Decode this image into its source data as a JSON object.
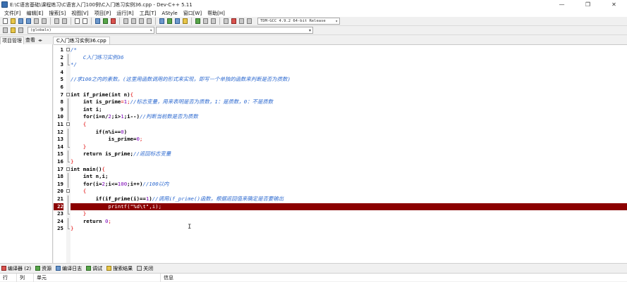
{
  "window": {
    "title": "E:\\C语言基础\\课程练习\\C语言入门100例\\C入门练习实例36.cpp - Dev-C++ 5.11",
    "minimize": "—",
    "maximize": "❐",
    "close": "✕"
  },
  "menu": [
    "文件[F]",
    "编辑[E]",
    "搜索[S]",
    "视图[V]",
    "项目[P]",
    "运行[R]",
    "工具[T]",
    "AStyle",
    "窗口[W]",
    "帮助[H]"
  ],
  "toolbar": {
    "compiler": "TDM-GCC 4.9.2 64-bit Release",
    "scope": "(globals)"
  },
  "left_panel": {
    "tabs": [
      "项目管理",
      "查看"
    ],
    "arrows": "◂▸"
  },
  "editor": {
    "file_tab": "C入门练习实例36.cpp",
    "line_numbers": [
      "1",
      "2",
      "3",
      "4",
      "5",
      "6",
      "7",
      "8",
      "9",
      "10",
      "11",
      "12",
      "13",
      "14",
      "15",
      "16",
      "17",
      "18",
      "19",
      "20",
      "21",
      "22",
      "23",
      "24",
      "25"
    ],
    "code": {
      "l1": "/*",
      "l2": "    C入门练习实例36",
      "l3": "*/",
      "l5": "//求100之内的素数。(这里用函数调用的形式来实现，即写一个单独的函数来判断是否为质数)",
      "l7a": "int",
      "l7b": " if_prime(",
      "l7c": "int",
      "l7d": " n)",
      "l7e": "{",
      "l8a": "    ",
      "l8b": "int",
      "l8c": " is_prime",
      "l8d": "=",
      "l8e": "1",
      "l8f": ";",
      "l8g": "//标志变量，用来表明是否为质数，1：是质数，0：不是质数",
      "l9a": "    ",
      "l9b": "int",
      "l9c": " i;",
      "l10a": "    ",
      "l10b": "for",
      "l10c": "(i=n/",
      "l10d": "2",
      "l10e": ";i>",
      "l10f": "1",
      "l10g": ";i--)",
      "l10h": "//判断当前数是否为质数",
      "l11": "    {",
      "l12a": "        ",
      "l12b": "if",
      "l12c": "(n%i==",
      "l12d": "0",
      "l12e": ")",
      "l13a": "            is_prime=",
      "l13b": "0",
      "l13c": ";",
      "l14": "    }",
      "l15a": "    ",
      "l15b": "return",
      "l15c": " is_prime;",
      "l15d": "//返回标志变量",
      "l16": "}",
      "l17a": "int",
      "l17b": " main()",
      "l17c": "{",
      "l18a": "    ",
      "l18b": "int",
      "l18c": " n,i;",
      "l19a": "    ",
      "l19b": "for",
      "l19c": "(i=",
      "l19d": "2",
      "l19e": ";i<=",
      "l19f": "100",
      "l19g": ";i++)",
      "l19h": "//100以内",
      "l20": "    {",
      "l21a": "        ",
      "l21b": "if",
      "l21c": "(if_prime(i)==",
      "l21d": "1",
      "l21e": ")",
      "l21f": "//调用if_prime()函数，根据返回值来确定是否要输出",
      "l22a": "            printf(",
      "l22b": "\"%d\\t\"",
      "l22c": ",i);",
      "l23": "    }",
      "l24a": "    ",
      "l24b": "return",
      "l24c": " ",
      "l24d": "0",
      "l24e": ";",
      "l25": "}"
    },
    "cursor_glyph": "I"
  },
  "bottom": {
    "tabs": [
      {
        "label": "编译器 (2)",
        "icon": "compiler-icon"
      },
      {
        "label": "资源",
        "icon": "resources-icon"
      },
      {
        "label": "编译日志",
        "icon": "compile-log-icon"
      },
      {
        "label": "调试",
        "icon": "debug-icon"
      },
      {
        "label": "搜索结果",
        "icon": "search-results-icon"
      },
      {
        "label": "关闭",
        "icon": "close-icon"
      }
    ],
    "columns": [
      "行",
      "列",
      "单元",
      "信息"
    ]
  },
  "colors": {
    "selected_line": "#8b0000",
    "comment": "#2f6bd0",
    "symbol": "#e00000",
    "number": "#7a00b5",
    "string": "#0000c0"
  }
}
